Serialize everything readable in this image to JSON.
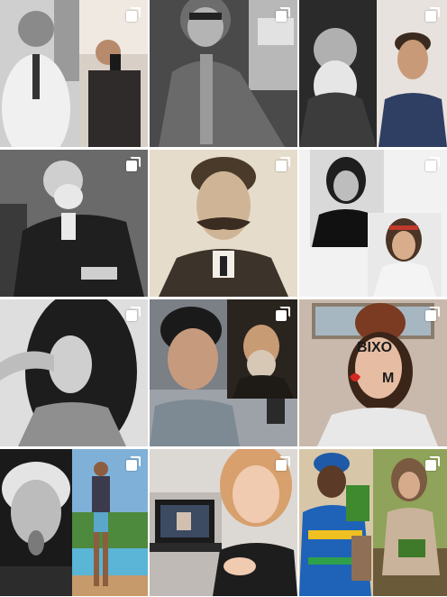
{
  "feed": {
    "posts": [
      {
        "left": "scientist-woman-portrait-bw",
        "right": "teen-boy-mirror-selfie",
        "multi": true
      },
      {
        "left": "scientist-man-glasses-portrait",
        "right": "",
        "multi": true
      },
      {
        "left": "bearded-elder-scientist-portrait",
        "right": "teen-boy-smiling",
        "multi": true
      },
      {
        "left": "elder-man-seated-portrait-bw",
        "right": "",
        "multi": true
      },
      {
        "left": "man-mustache-sepia-portrait",
        "right": "",
        "multi": true
      },
      {
        "left": "woman-portrait-bw",
        "right": "teen-girl-headband",
        "multi": true
      },
      {
        "left": "teen-girl-bw-pose",
        "right": "",
        "multi": true
      },
      {
        "left": "teen-boy-selfie",
        "right": "bearded-man-painting",
        "multi": true
      },
      {
        "left": "girl-face-painted-bixo",
        "right": "",
        "multi": true
      },
      {
        "left": "elder-scientist-tongue-out",
        "right": "teen-boy-pool",
        "multi": true
      },
      {
        "left": "teen-girl-with-laptop",
        "right": "",
        "multi": true
      },
      {
        "left": "woman-with-plant",
        "right": "teen-girl-with-plant",
        "multi": true
      }
    ],
    "face_paint_text": "BIXO",
    "face_paint_text2": "M"
  }
}
